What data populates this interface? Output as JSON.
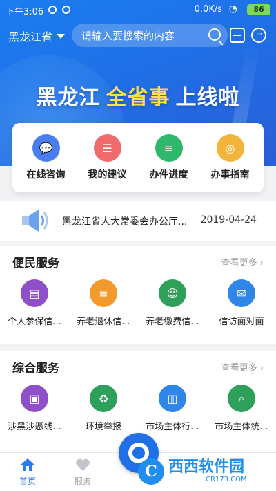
{
  "status_bar": {
    "time": "下午3:06",
    "net_speed": "0.0K/s",
    "battery": "86"
  },
  "topbar": {
    "city": "黑龙江省",
    "search_placeholder": "请输入要搜索的内容"
  },
  "banner": {
    "part1": "黑龙江",
    "part2": "全省事",
    "part3": "上线啦"
  },
  "quick_actions": [
    {
      "label": "在线咨询",
      "icon": "chat-icon",
      "color": "#4a7ef0"
    },
    {
      "label": "我的建议",
      "icon": "document-icon",
      "color": "#ef6a6a"
    },
    {
      "label": "办件进度",
      "icon": "list-icon",
      "color": "#2fb86b"
    },
    {
      "label": "办事指南",
      "icon": "compass-icon",
      "color": "#f2b43a"
    }
  ],
  "notice": {
    "title": "黑龙江省人大常委会办公厅...",
    "date": "2019-04-24"
  },
  "section1": {
    "title": "便民服务",
    "more": "查看更多",
    "items": [
      {
        "label": "个人参保信...",
        "icon": "insurance-doc-icon",
        "color": "#8e4fc8"
      },
      {
        "label": "养老退休信...",
        "icon": "pension-icon",
        "color": "#f29a2e"
      },
      {
        "label": "养老缴费信...",
        "icon": "elderly-person-icon",
        "color": "#2fa05a"
      },
      {
        "label": "信访面对面",
        "icon": "envelope-icon",
        "color": "#2f86e8"
      }
    ]
  },
  "section2": {
    "title": "综合服务",
    "more": "查看更多",
    "items": [
      {
        "label": "涉黑涉恶线...",
        "icon": "report-box-icon",
        "color": "#8e4fc8"
      },
      {
        "label": "环境举报",
        "icon": "recycle-icon",
        "color": "#2fa05a"
      },
      {
        "label": "市场主体行...",
        "icon": "building-icon",
        "color": "#2f86e8"
      },
      {
        "label": "市场主体统...",
        "icon": "search-doc-icon",
        "color": "#2fa05a"
      }
    ]
  },
  "bottom_nav": {
    "home": "首页",
    "service": "服务"
  },
  "watermark": {
    "brand": "西西软件园",
    "url": "CR173.COM"
  }
}
